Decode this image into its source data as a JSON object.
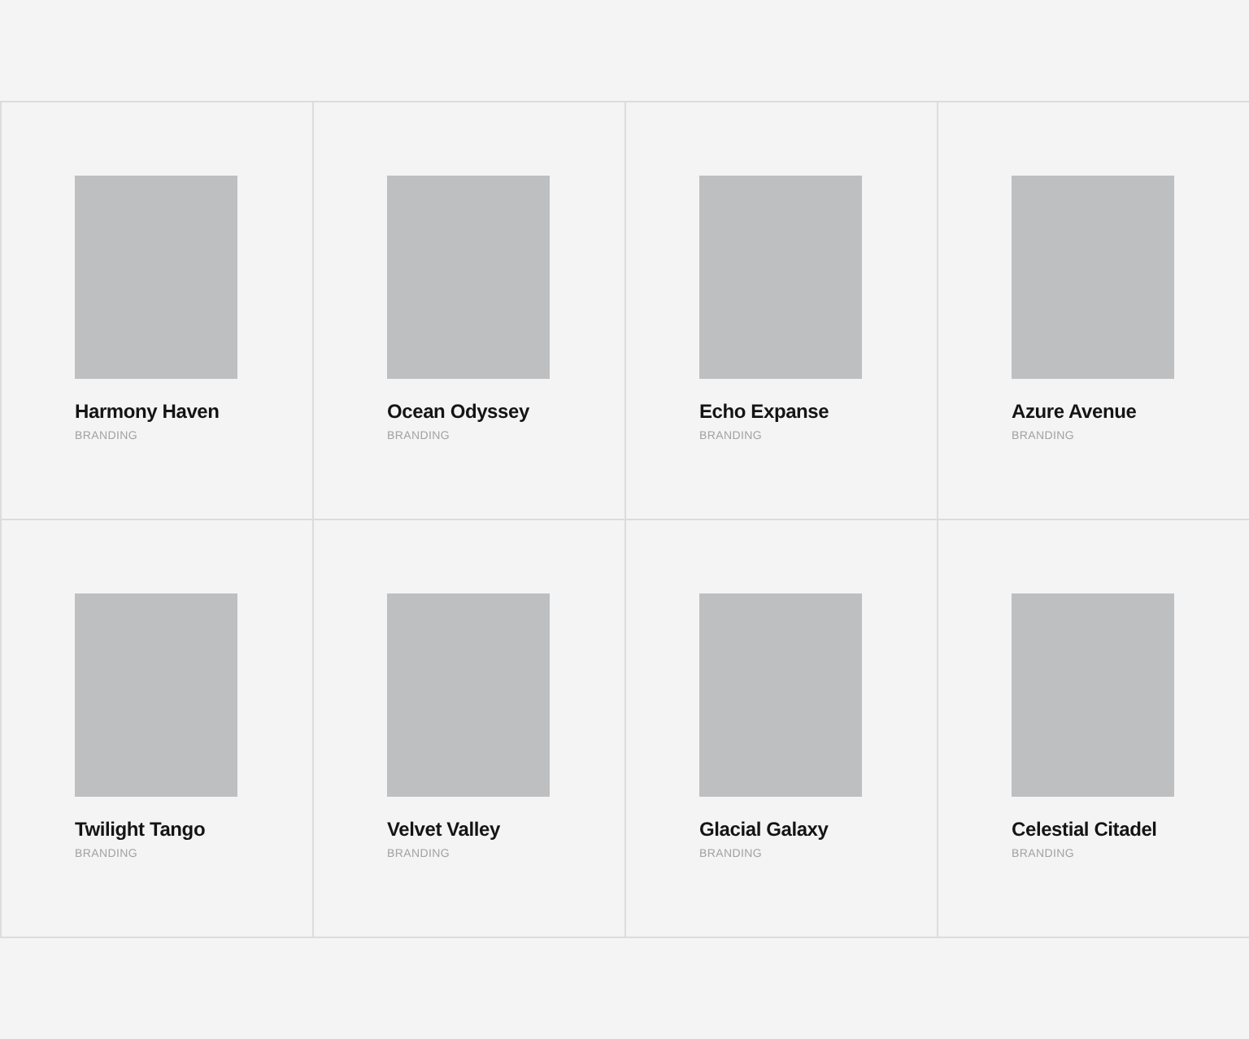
{
  "projects": [
    {
      "title": "Harmony Haven",
      "category": "BRANDING"
    },
    {
      "title": "Ocean Odyssey",
      "category": "BRANDING"
    },
    {
      "title": "Echo Expanse",
      "category": "BRANDING"
    },
    {
      "title": "Azure Avenue",
      "category": "BRANDING"
    },
    {
      "title": "Twilight Tango",
      "category": "BRANDING"
    },
    {
      "title": "Velvet Valley",
      "category": "BRANDING"
    },
    {
      "title": "Glacial Galaxy",
      "category": "BRANDING"
    },
    {
      "title": "Celestial Citadel",
      "category": "BRANDING"
    }
  ]
}
